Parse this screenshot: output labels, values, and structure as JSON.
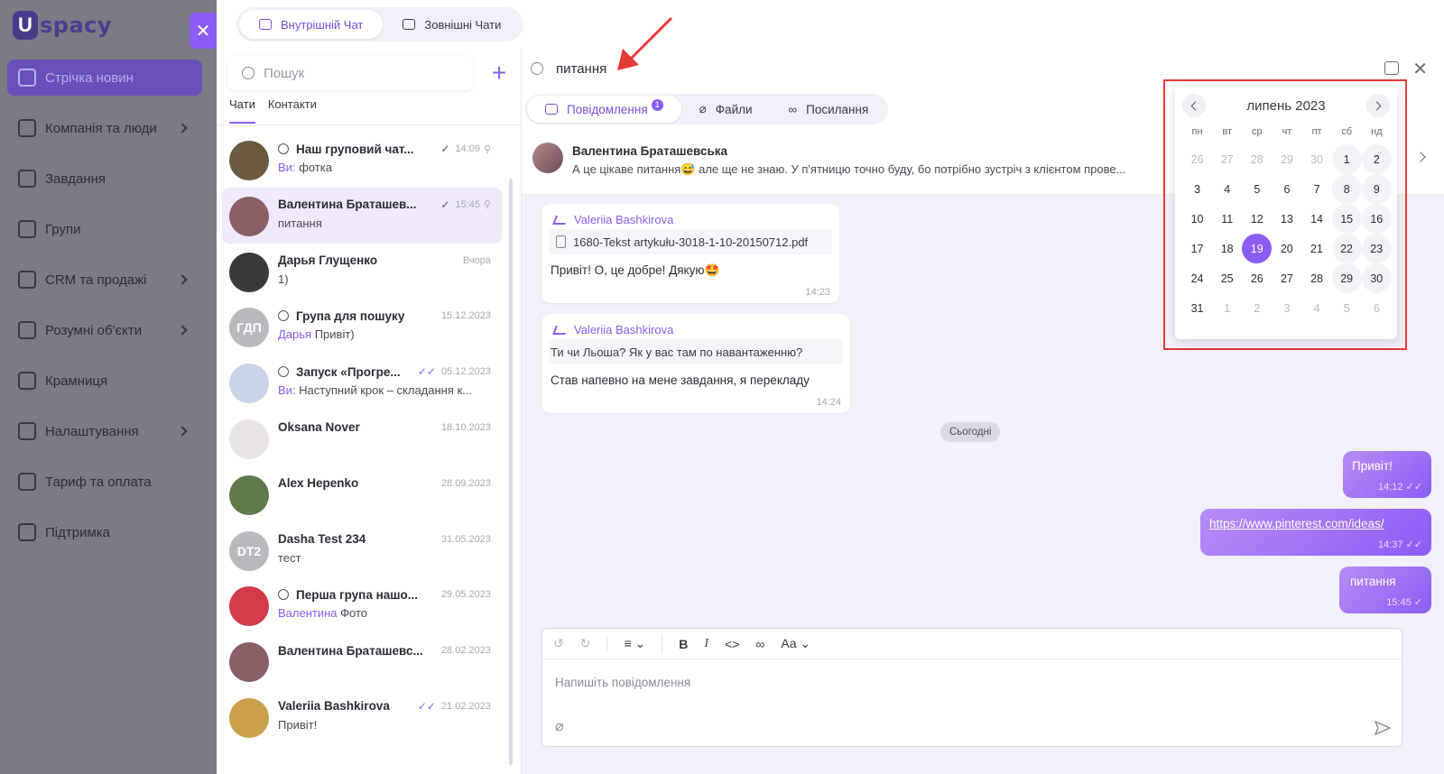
{
  "app": {
    "logo_letter": "U",
    "logo_text": "spacy",
    "close_label": "✕"
  },
  "nav": [
    {
      "label": "Стрічка новин",
      "icon": "news-icon",
      "chevron": false
    },
    {
      "label": "Компанія та люди",
      "icon": "company-icon",
      "chevron": true
    },
    {
      "label": "Завдання",
      "icon": "tasks-icon",
      "chevron": false
    },
    {
      "label": "Групи",
      "icon": "groups-icon",
      "chevron": false
    },
    {
      "label": "CRM та продажі",
      "icon": "crm-icon",
      "chevron": true
    },
    {
      "label": "Розумні об'єкти",
      "icon": "smart-objects-icon",
      "chevron": true
    },
    {
      "label": "Крамниця",
      "icon": "store-icon",
      "chevron": false
    },
    {
      "label": "Налаштування",
      "icon": "settings-icon",
      "chevron": true
    },
    {
      "label": "Тариф та оплата",
      "icon": "billing-icon",
      "chevron": false
    },
    {
      "label": "Підтримка",
      "icon": "support-icon",
      "chevron": false
    }
  ],
  "top_tabs": [
    {
      "label": "Внутрішній Чат"
    },
    {
      "label": "Зовнішні Чати"
    }
  ],
  "chat_list": {
    "search_placeholder": "Пошук",
    "add_label": "+",
    "tabs": [
      "Чати",
      "Контакти"
    ],
    "items": [
      {
        "name": "Наш груповий чат...",
        "group": true,
        "time": "14:09",
        "check": "✓",
        "pinned": true,
        "sender": "Ви:",
        "text": "фотка",
        "avatar_color": "#6b5a3e"
      },
      {
        "name": "Валентина Браташев...",
        "group": false,
        "time": "15:45",
        "check": "✓",
        "pinned": true,
        "sender": "",
        "text": "питання",
        "avatar_color": "#8a5f66"
      },
      {
        "name": "Дарья Глущенко",
        "group": false,
        "time": "Вчора",
        "check": "",
        "pinned": false,
        "sender": "",
        "text": "1)",
        "avatar_color": "#3a3a3a"
      },
      {
        "name": "Група для пошуку",
        "group": true,
        "time": "15.12.2023",
        "check": "",
        "pinned": false,
        "sender": "Дарья",
        "text": "Привіт)",
        "avatar_color": "#b8b8be",
        "initials": "ГДП"
      },
      {
        "name": "Запуск «Прогре...",
        "group": true,
        "time": "05.12.2023",
        "check": "✓✓",
        "pinned": false,
        "sender": "Ви:",
        "text": "Наступний крок – складання к...",
        "avatar_color": "#c9d4e8"
      },
      {
        "name": "Oksana Nover",
        "group": false,
        "time": "18.10.2023",
        "check": "",
        "pinned": false,
        "sender": "",
        "text": "",
        "avatar_color": "#e9e2e6"
      },
      {
        "name": "Alex Нерenko",
        "group": false,
        "time": "28.09.2023",
        "check": "",
        "pinned": false,
        "sender": "",
        "text": "",
        "avatar_color": "#5d7a4a"
      },
      {
        "name": "Dasha Test 234",
        "group": false,
        "time": "31.05.2023",
        "check": "",
        "pinned": false,
        "sender": "",
        "text": "тест",
        "avatar_color": "#b8b8be",
        "initials": "DT2"
      },
      {
        "name": "Перша група нашо...",
        "group": true,
        "time": "29.05.2023",
        "check": "",
        "pinned": false,
        "sender": "Валентина",
        "text": "Фото",
        "avatar_color": "#d33a4a"
      },
      {
        "name": "Валентина Браташевс...",
        "group": false,
        "time": "28.02.2023",
        "check": "",
        "pinned": false,
        "sender": "",
        "text": "",
        "avatar_color": "#8a5f66"
      },
      {
        "name": "Valeriia Bashkirova",
        "group": false,
        "time": "21.02.2023",
        "check": "✓✓",
        "pinned": false,
        "sender": "",
        "text": "Привіт!",
        "avatar_color": "#caa04a"
      }
    ]
  },
  "search": {
    "query": "питання",
    "tabs": [
      {
        "label": "Повідомлення",
        "badge": "1"
      },
      {
        "label": "Файли"
      },
      {
        "label": "Посилання"
      }
    ],
    "result": {
      "name": "Валентина Браташевська",
      "text": "А це цікаве питання😅 але ще не знаю. У п'ятницю точно буду, бо потрібно зустріч з клієнтом прове..."
    }
  },
  "messages": {
    "m1": {
      "from": "Valeriia Bashkirova",
      "file": "1680-Tekst artykułu-3018-1-10-20150712.pdf",
      "text": "Привіт! О, це добре! Дякую🤩",
      "time": "14:23"
    },
    "m2": {
      "from": "Valeriia Bashkirova",
      "quote": "Ти чи Льоша? Як у вас там по навантаженню?",
      "text": "Став напевно на мене завдання, я перекладу",
      "time": "14:24"
    },
    "day": "Сьогодні",
    "out1": {
      "text": "Привіт!",
      "time": "14:12"
    },
    "out2": {
      "text": "https://www.pinterest.com/ideas/",
      "time": "14:37"
    },
    "out3": {
      "text": "питання",
      "time": "15:45"
    }
  },
  "composer": {
    "placeholder": "Напишіть повідомлення",
    "bold": "B",
    "italic": "I",
    "code": "<>",
    "font": "Aa"
  },
  "calendar": {
    "month_label": "липень 2023",
    "weekdays": [
      "пн",
      "вт",
      "ср",
      "чт",
      "пт",
      "сб",
      "нд"
    ],
    "days": [
      {
        "d": "26",
        "o": true
      },
      {
        "d": "27",
        "o": true
      },
      {
        "d": "28",
        "o": true
      },
      {
        "d": "29",
        "o": true
      },
      {
        "d": "30",
        "o": true
      },
      {
        "d": "1"
      },
      {
        "d": "2"
      },
      {
        "d": "3"
      },
      {
        "d": "4"
      },
      {
        "d": "5"
      },
      {
        "d": "6"
      },
      {
        "d": "7"
      },
      {
        "d": "8"
      },
      {
        "d": "9"
      },
      {
        "d": "10"
      },
      {
        "d": "11"
      },
      {
        "d": "12"
      },
      {
        "d": "13"
      },
      {
        "d": "14"
      },
      {
        "d": "15"
      },
      {
        "d": "16"
      },
      {
        "d": "17"
      },
      {
        "d": "18"
      },
      {
        "d": "19",
        "sel": true
      },
      {
        "d": "20"
      },
      {
        "d": "21"
      },
      {
        "d": "22"
      },
      {
        "d": "23"
      },
      {
        "d": "24"
      },
      {
        "d": "25"
      },
      {
        "d": "26"
      },
      {
        "d": "27"
      },
      {
        "d": "28"
      },
      {
        "d": "29"
      },
      {
        "d": "30"
      },
      {
        "d": "31"
      },
      {
        "d": "1",
        "o": true
      },
      {
        "d": "2",
        "o": true
      },
      {
        "d": "3",
        "o": true
      },
      {
        "d": "4",
        "o": true
      },
      {
        "d": "5",
        "o": true
      },
      {
        "d": "6",
        "o": true
      }
    ]
  },
  "colors": {
    "accent": "#8b5cf6",
    "highlight_frame": "#e53935",
    "arrow": "#e53935"
  }
}
